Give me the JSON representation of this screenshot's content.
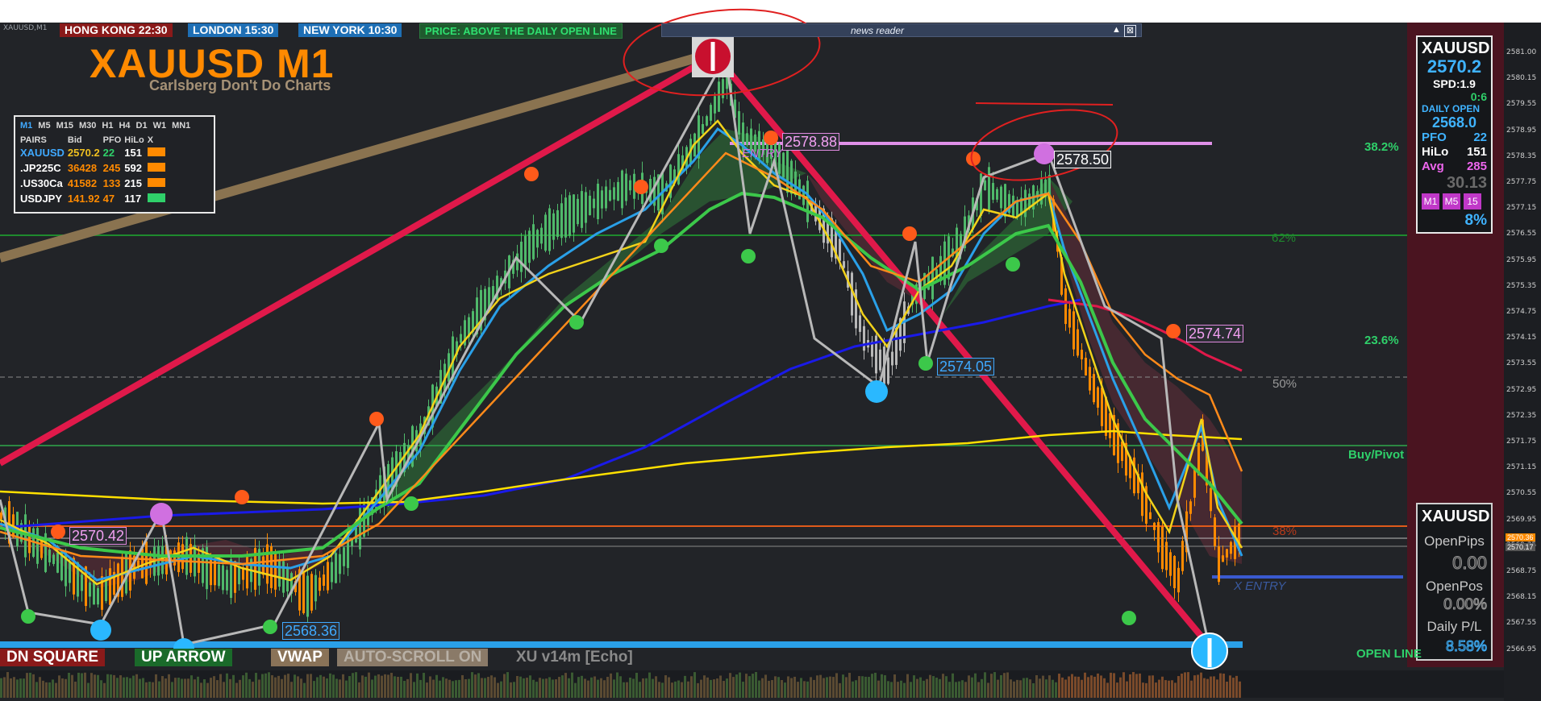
{
  "window": {
    "symbol_tf": "XAUUSD,M1"
  },
  "clocks": [
    {
      "label": "HONG KONG  22:30",
      "color": "#8a1a1a"
    },
    {
      "label": "LONDON   15:30",
      "color": "#1e6fb5"
    },
    {
      "label": "NEW YORK  10:30",
      "color": "#1e6fb5"
    }
  ],
  "price_status": "PRICE: ABOVE THE DAILY OPEN LINE",
  "news_reader": {
    "title": "news reader",
    "up_label": "▲",
    "close_label": "⊠"
  },
  "chart_title": "XAUUSD M1",
  "chart_subtitle": "Carlsberg Don't Do Charts",
  "pairs_panel": {
    "timeframes": [
      "M1",
      "M5",
      "M15",
      "M30",
      "H1",
      "H4",
      "D1",
      "W1",
      "MN1"
    ],
    "active_timeframe": "M1",
    "headers": [
      "PAIRS",
      "Bid",
      "PFO",
      "HiLo",
      "X"
    ],
    "rows": [
      {
        "pair": "XAUUSD",
        "bid": "2570.2",
        "pfo": "22",
        "hilo": "151",
        "pair_color": "#3fa9ff",
        "bid_color": "#f0c020",
        "pfo_color": "#2fd06a",
        "x_color": "#ff8a00"
      },
      {
        "pair": ".JP225C",
        "bid": "36428",
        "pfo": "245",
        "hilo": "592",
        "pair_color": "#ffffff",
        "bid_color": "#ff8a00",
        "pfo_color": "#ff8a00",
        "x_color": "#ff8a00"
      },
      {
        "pair": ".US30Ca",
        "bid": "41582",
        "pfo": "133",
        "hilo": "215",
        "pair_color": "#ffffff",
        "bid_color": "#ff8a00",
        "pfo_color": "#ff8a00",
        "x_color": "#ff8a00"
      },
      {
        "pair": "USDJPY",
        "bid": "141.92",
        "pfo": "47",
        "hilo": "117",
        "pair_color": "#ffffff",
        "bid_color": "#ff8a00",
        "pfo_color": "#ff8a00",
        "x_color": "#2fd06a"
      }
    ]
  },
  "info_panel": {
    "symbol": "XAUUSD",
    "price": "2570.2",
    "spread": "SPD:1.9",
    "change": "0:6",
    "daily_open_label": "DAILY OPEN",
    "daily_open": "2568.0",
    "pfo_label": "PFO",
    "pfo": "22",
    "hilo_label": "HiLo",
    "hilo": "151",
    "avg_label": "Avg",
    "avg": "285",
    "extra": "30.13",
    "tf_buttons": [
      "M1",
      "M5",
      "15"
    ],
    "percent": "8%"
  },
  "account_panel": {
    "symbol": "XAUUSD",
    "open_pips_label": "OpenPips",
    "open_pips": "0.00",
    "open_pos_label": "OpenPos",
    "open_pos": "0.00%",
    "daily_pl_label": "Daily P/L",
    "daily_pl": "8.58%"
  },
  "level_labels": {
    "fib_382": "38.2%",
    "fib_236": "23.6%",
    "fib_62": "62%",
    "fib_50": "50%",
    "fib_38": "38%",
    "buy_pivot": "Buy/Pivot",
    "open_line": "OPEN LINE",
    "entry_left": "ENTRY",
    "entry_right": "X ENTRY"
  },
  "price_labels": [
    {
      "text": "2578.88",
      "bg": "#2a2d33",
      "color": "#f2a0f2",
      "border": "#e08ae0"
    },
    {
      "text": "2578.50",
      "bg": "#2a2d33",
      "color": "#ffffff",
      "border": "#ffffff"
    },
    {
      "text": "2574.74",
      "bg": "#2a2d33",
      "color": "#f2a0f2",
      "border": "#e08ae0"
    },
    {
      "text": "2574.05",
      "bg": "#2a2d33",
      "color": "#3fa9ff",
      "border": "#3fa9ff"
    },
    {
      "text": "2570.42",
      "bg": "#2a2d33",
      "color": "#f2a0f2",
      "border": "#e08ae0"
    },
    {
      "text": "2568.36",
      "bg": "#2a2d33",
      "color": "#3fa9ff",
      "border": "#3fa9ff"
    }
  ],
  "price_axis": [
    "2581.00",
    "2580.15",
    "2579.55",
    "2578.95",
    "2578.35",
    "2577.75",
    "2577.15",
    "2576.55",
    "2575.95",
    "2575.35",
    "2574.75",
    "2574.15",
    "2573.55",
    "2572.95",
    "2572.35",
    "2571.75",
    "2571.15",
    "2570.55",
    "2569.95",
    "2569.35",
    "2568.75",
    "2568.15",
    "2567.55",
    "2566.95"
  ],
  "price_axis_marks": [
    {
      "text": "2570.36",
      "bg": "#ff8a00"
    },
    {
      "text": "2570.17",
      "bg": "#555"
    }
  ],
  "bottom_buttons": [
    {
      "label": "DN SQUARE",
      "bg": "#8a1a1a"
    },
    {
      "label": "UP ARROW",
      "bg": "#1a6a2a"
    },
    {
      "label": "VWAP",
      "bg": "#8a7358"
    },
    {
      "label": "AUTO-SCROLL ON",
      "bg": "#8a7a68"
    }
  ],
  "version_label": "XU v14m [Echo]",
  "colors": {
    "background": "#222428",
    "bull": "#4fb86a",
    "bear": "#ff8a00",
    "wedge": "#e0194a",
    "ema_fast": "#f2d21a",
    "ema_blue": "#2aa0e8",
    "ema_green": "#3cc84a",
    "ema_orange": "#ff8a1a",
    "ma_slow": "#1a1ae8",
    "vwap": "#ffe000",
    "annotation": "#e02020"
  }
}
